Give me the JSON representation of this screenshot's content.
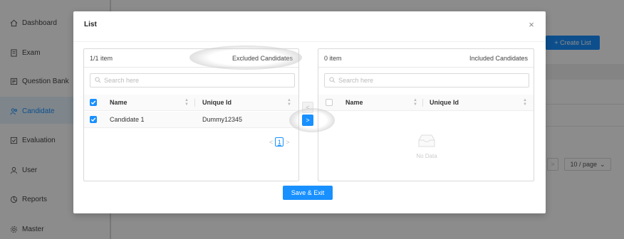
{
  "sidebar": {
    "items": [
      {
        "label": "Dashboard",
        "icon": "home-icon"
      },
      {
        "label": "Exam",
        "icon": "document-icon"
      },
      {
        "label": "Question Bank",
        "icon": "bank-icon"
      },
      {
        "label": "Candidate",
        "icon": "candidate-icon",
        "active": true
      },
      {
        "label": "Evaluation",
        "icon": "evaluation-icon"
      },
      {
        "label": "User",
        "icon": "user-icon"
      },
      {
        "label": "Reports",
        "icon": "reports-icon"
      },
      {
        "label": "Master",
        "icon": "gear-icon"
      }
    ]
  },
  "main": {
    "create_list_label": "+ Create List",
    "pager_next": ">",
    "page_size": "10 / page"
  },
  "modal": {
    "title": "List",
    "close": "×",
    "left": {
      "count": "1/1 item",
      "title": "Excluded Candidates",
      "search_placeholder": "Search here",
      "col_name": "Name",
      "col_id": "Unique Id",
      "rows": [
        {
          "name": "Candidate 1",
          "id": "Dummy12345"
        }
      ],
      "pagination": {
        "prev": "<",
        "current": "1",
        "next": ">"
      }
    },
    "right": {
      "count": "0 item",
      "title": "Included Candidates",
      "search_placeholder": "Search here",
      "col_name": "Name",
      "col_id": "Unique Id",
      "empty_text": "No Data"
    },
    "move_left": "<",
    "move_right": ">",
    "save_label": "Save & Exit"
  },
  "colors": {
    "primary": "#1890ff",
    "overlay": "rgba(0,0,0,0.45)"
  }
}
